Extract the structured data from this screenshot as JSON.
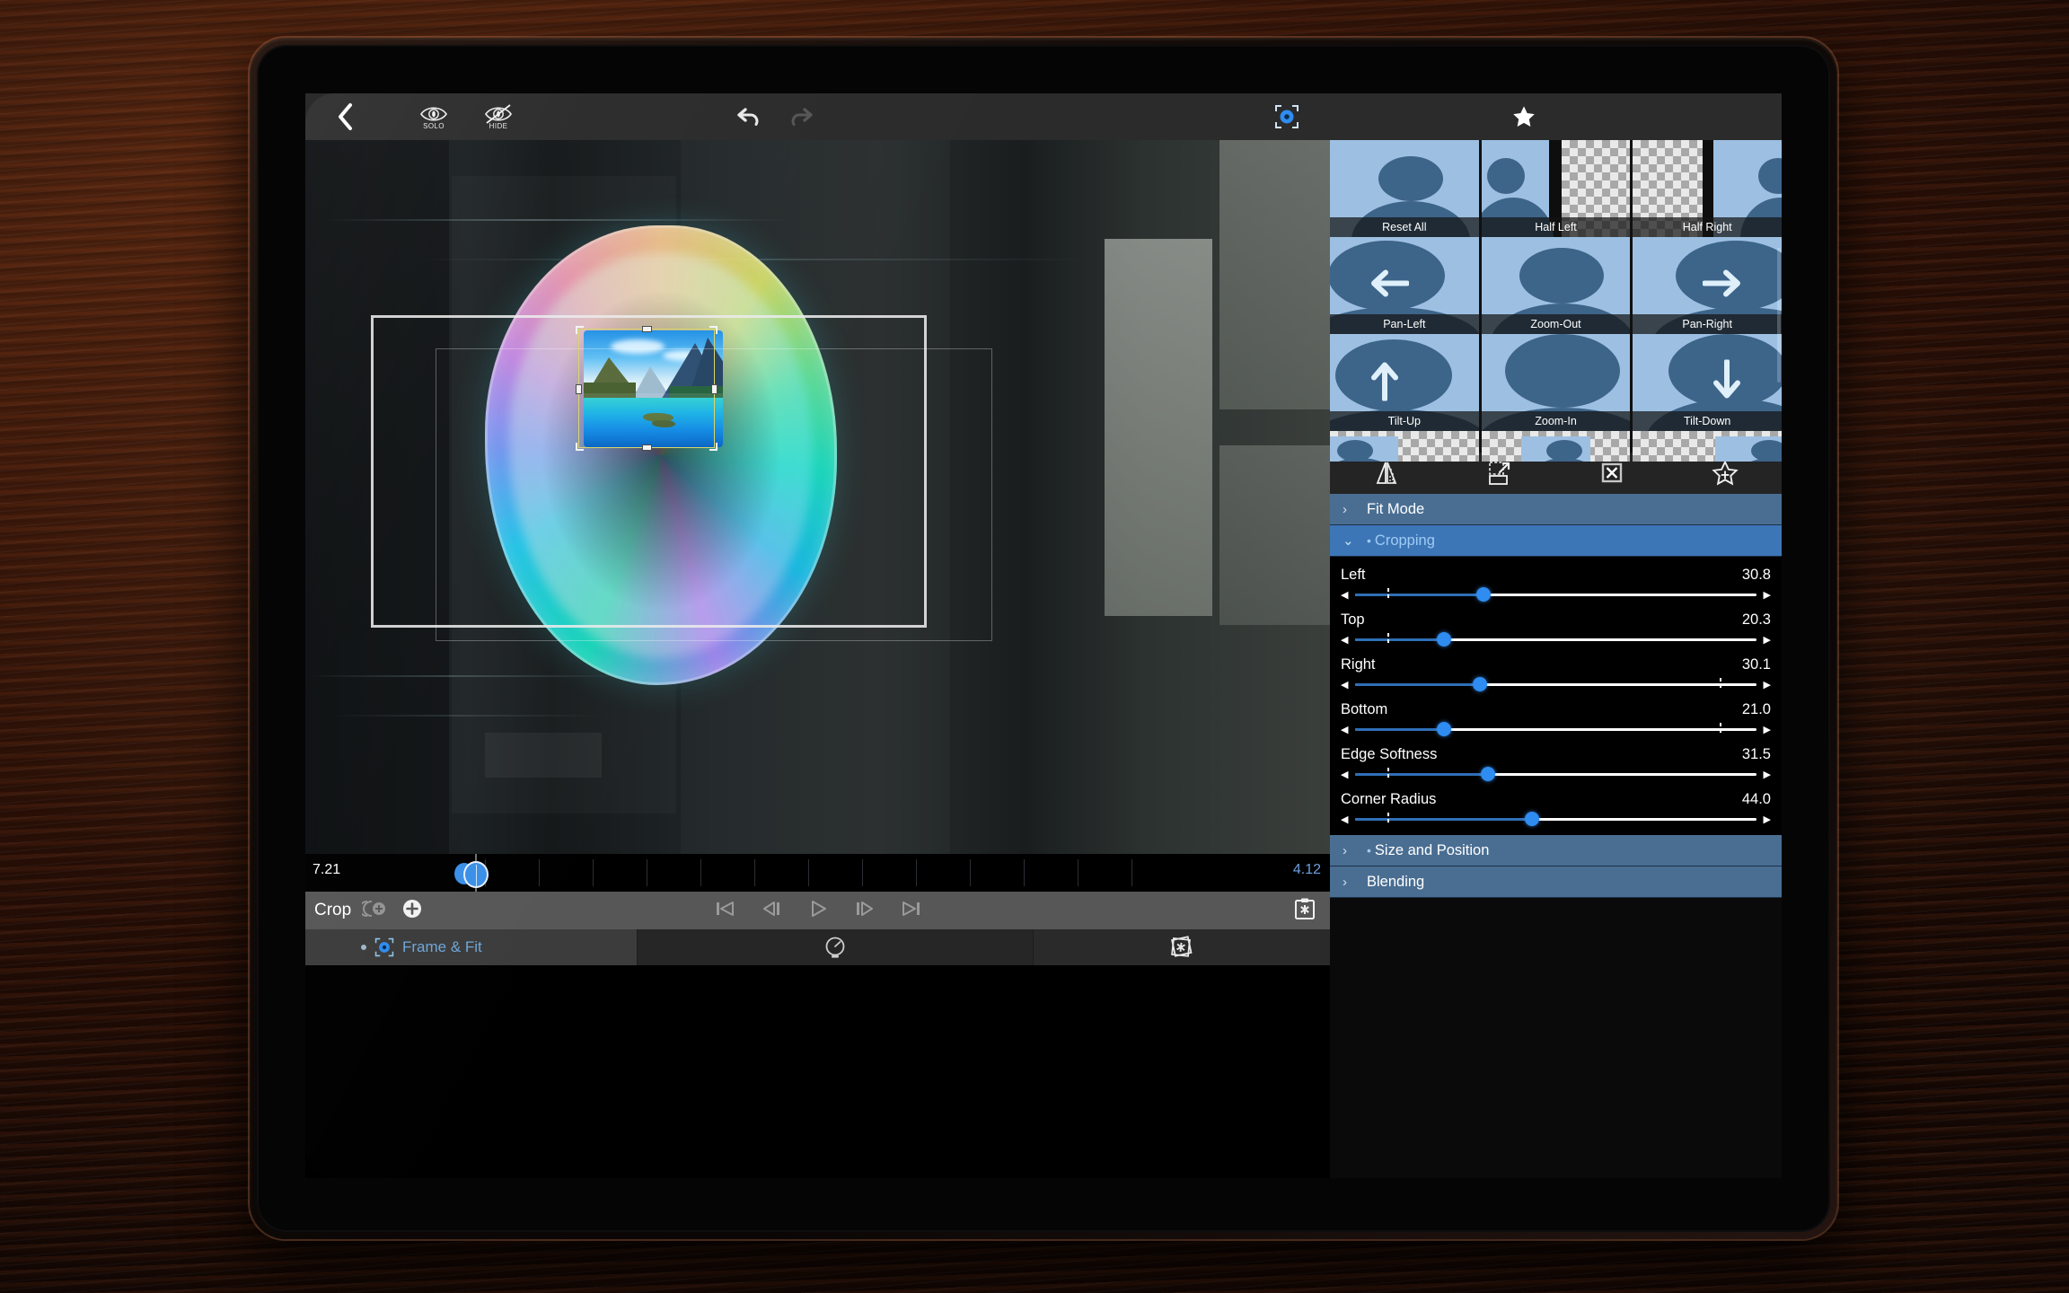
{
  "app": {
    "device": "tablet",
    "accent_color": "#2f8cf0",
    "section_header_color": "#4a6e92",
    "section_open_color": "#3d76b6"
  },
  "topbar": {
    "back_label": "‹",
    "solo_label": "SOLO",
    "hide_label": "HIDE",
    "undo_label": "undo",
    "redo_label": "redo",
    "frame_fit_label": "Frame & Fit",
    "favorite_label": "Favorite"
  },
  "canvas": {
    "subject": "soap bubble with mountain lake landscape",
    "selection_color": "#d9d66a",
    "frame_color": "#ebebeb"
  },
  "timeline": {
    "start_time": "7.21",
    "end_time": "4.12",
    "track_label": "Crop",
    "add_keyframe_label": "+",
    "ripple_label": "ripple",
    "transport": [
      {
        "name": "skip-to-start",
        "glyph": "⏮"
      },
      {
        "name": "step-back",
        "glyph": "⏴"
      },
      {
        "name": "play",
        "glyph": "▷"
      },
      {
        "name": "step-forward",
        "glyph": "⏵"
      },
      {
        "name": "skip-to-end",
        "glyph": "⏭"
      }
    ],
    "clip_label": "Frame & Fit"
  },
  "inspector": {
    "presets": [
      [
        {
          "label": "Reset All",
          "style": "full",
          "arrow": ""
        },
        {
          "label": "Half Left",
          "style": "half-left",
          "arrow": ""
        },
        {
          "label": "Half Right",
          "style": "half-right",
          "arrow": ""
        }
      ],
      [
        {
          "label": "Pan-Left",
          "style": "full-big",
          "arrow": "←"
        },
        {
          "label": "Zoom-Out",
          "style": "full-sm",
          "arrow": ""
        },
        {
          "label": "Pan-Right",
          "style": "full-big",
          "arrow": "→"
        }
      ],
      [
        {
          "label": "Tilt-Up",
          "style": "full-big",
          "arrow": "↑"
        },
        {
          "label": "Zoom-In",
          "style": "full-huge",
          "arrow": ""
        },
        {
          "label": "Tilt-Down",
          "style": "full-big",
          "arrow": "↓"
        }
      ]
    ],
    "tool_icons": [
      {
        "name": "mirror-icon"
      },
      {
        "name": "reset-transform-icon"
      },
      {
        "name": "crop-box-icon"
      },
      {
        "name": "add-favorite-star-icon"
      }
    ],
    "sections": [
      {
        "label": "Fit Mode",
        "state": "collapsed",
        "modified": false
      },
      {
        "label": "Cropping",
        "state": "expanded",
        "modified": true
      },
      {
        "label": "Size and Position",
        "state": "collapsed",
        "modified": true
      },
      {
        "label": "Blending",
        "state": "collapsed",
        "modified": false
      }
    ],
    "sliders": [
      {
        "label": "Left",
        "value": "30.8",
        "pct": 32,
        "default_pct": 8
      },
      {
        "label": "Top",
        "value": "20.3",
        "pct": 22,
        "default_pct": 8
      },
      {
        "label": "Right",
        "value": "30.1",
        "pct": 31,
        "default_pct": 91
      },
      {
        "label": "Bottom",
        "value": "21.0",
        "pct": 22,
        "default_pct": 91
      },
      {
        "label": "Edge Softness",
        "value": "31.5",
        "pct": 33,
        "default_pct": 8
      },
      {
        "label": "Corner Radius",
        "value": "44.0",
        "pct": 44,
        "default_pct": 8
      }
    ]
  }
}
